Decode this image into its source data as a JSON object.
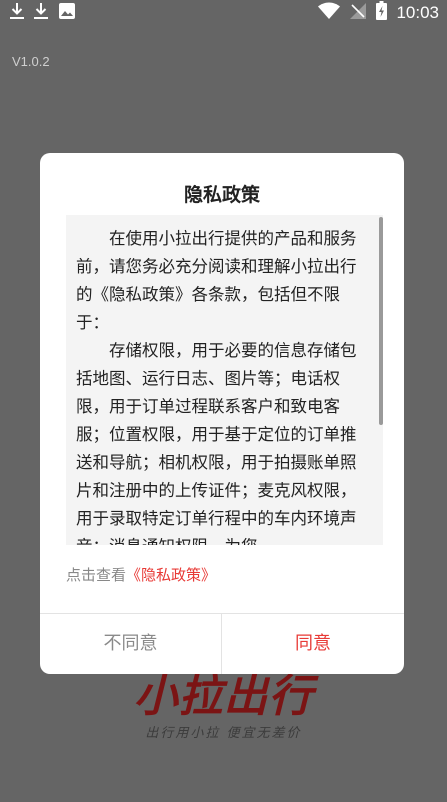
{
  "status_bar": {
    "time": "10:03",
    "left_icons": [
      "download-icon",
      "download-icon",
      "image-icon"
    ],
    "right_icons": [
      "wifi-icon",
      "signal-icon",
      "battery-icon"
    ]
  },
  "version": "V1.0.2",
  "brand": {
    "logo": "小拉出行",
    "slogan": "出行用小拉 便宜无差价"
  },
  "dialog": {
    "title": "隐私政策",
    "paragraphs": [
      "在使用小拉出行提供的产品和服务前，请您务必充分阅读和理解小拉出行的《隐私政策》各条款，包括但不限于：",
      "存储权限，用于必要的信息存储包括地图、运行日志、图片等；电话权限，用于订单过程联系客户和致电客服；位置权限，用于基于定位的订单推送和导航；相机权限，用于拍摄账单照片和注册中的上传证件；麦克风权限，用于录取特定订单行程中的车内环境声音；消息通知权限，为您"
    ],
    "link_prefix": "点击查看",
    "link_text": "《隐私政策》",
    "disagree_label": "不同意",
    "agree_label": "同意"
  },
  "colors": {
    "accent": "#e83a36",
    "overlay": "#656565",
    "brand": "#7b1414"
  }
}
